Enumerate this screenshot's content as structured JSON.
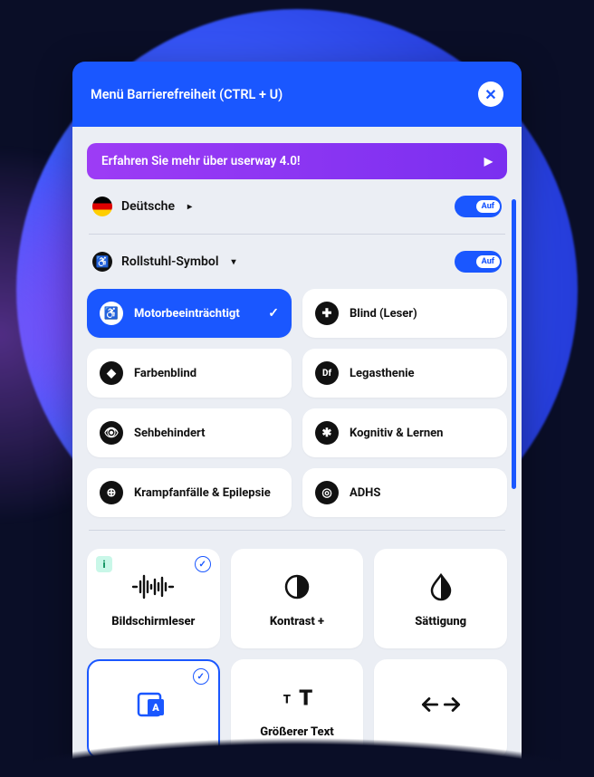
{
  "header": {
    "title": "Menü Barrierefreiheit (CTRL + U)",
    "close_label": "✕"
  },
  "banner": {
    "text": "Erfahren Sie mehr über userway 4.0!",
    "arrow": "▶"
  },
  "language": {
    "label": "Deütsche",
    "arrow": "▸",
    "toggle_label": "Auf"
  },
  "symbol": {
    "label": "Rollstuhl-Symbol",
    "arrow": "▾",
    "toggle_label": "Auf"
  },
  "profiles": [
    {
      "icon": "♿",
      "label": "Motorbeeinträchtigt",
      "active": true,
      "check": "✓"
    },
    {
      "icon": "✚",
      "label": "Blind (Leser)"
    },
    {
      "icon": "◆",
      "label": "Farbenblind"
    },
    {
      "icon": "Df",
      "label": "Legasthenie"
    },
    {
      "icon": "👁",
      "label": "Sehbehindert"
    },
    {
      "icon": "✱",
      "label": "Kognitiv & Lernen"
    },
    {
      "icon": "⊕",
      "label": "Krampfanfälle & Epilepsie"
    },
    {
      "icon": "◎",
      "label": "ADHS"
    }
  ],
  "features": [
    {
      "label": "Bildschirmleser",
      "icon_name": "audio-wave-icon",
      "info": "i",
      "checked": "✓"
    },
    {
      "label": "Kontrast +",
      "icon_name": "contrast-icon"
    },
    {
      "label": "Sättigung",
      "icon_name": "drop-icon"
    },
    {
      "label": "",
      "icon_name": "smart-contrast-icon",
      "selected": true,
      "checked": "✓"
    },
    {
      "label": "Größerer Text",
      "icon_name": "text-size-icon"
    },
    {
      "label": "",
      "icon_name": "spacing-icon"
    }
  ],
  "icons": {
    "close": "✕",
    "check": "✓",
    "arrow_right_small": "▸",
    "caret_down": "▾",
    "wheelchair": "♿"
  },
  "colors": {
    "primary": "#1a57ff",
    "banner_purple": "#8a2be2",
    "panel_bg": "#ebeef4",
    "bg": "#0a0e27"
  }
}
